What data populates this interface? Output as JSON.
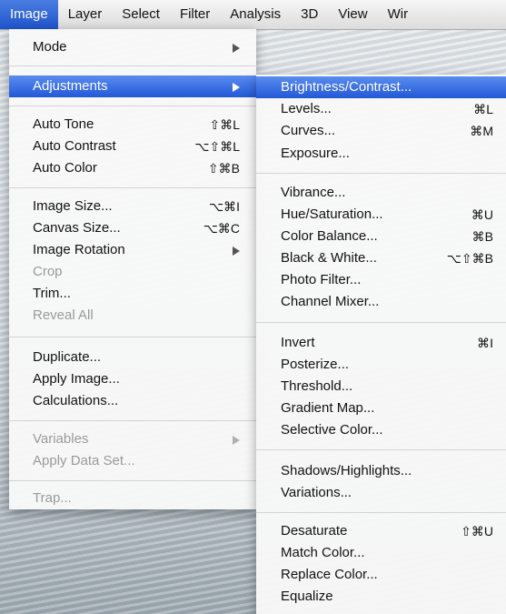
{
  "menubar": {
    "items": [
      "Image",
      "Layer",
      "Select",
      "Filter",
      "Analysis",
      "3D",
      "View",
      "Wir"
    ]
  },
  "image_menu": {
    "mode": "Mode",
    "adjustments": "Adjustments",
    "auto_tone": {
      "label": "Auto Tone",
      "shortcut": "⇧⌘L"
    },
    "auto_contrast": {
      "label": "Auto Contrast",
      "shortcut": "⌥⇧⌘L"
    },
    "auto_color": {
      "label": "Auto Color",
      "shortcut": "⇧⌘B"
    },
    "image_size": {
      "label": "Image Size...",
      "shortcut": "⌥⌘I"
    },
    "canvas_size": {
      "label": "Canvas Size...",
      "shortcut": "⌥⌘C"
    },
    "image_rotation": "Image Rotation",
    "crop": "Crop",
    "trim": "Trim...",
    "reveal_all": "Reveal All",
    "duplicate": "Duplicate...",
    "apply_image": "Apply Image...",
    "calculations": "Calculations...",
    "variables": "Variables",
    "apply_data_set": "Apply Data Set...",
    "trap": "Trap..."
  },
  "adjustments_menu": {
    "brightness_contrast": "Brightness/Contrast...",
    "levels": {
      "label": "Levels...",
      "shortcut": "⌘L"
    },
    "curves": {
      "label": "Curves...",
      "shortcut": "⌘M"
    },
    "exposure": "Exposure...",
    "vibrance": "Vibrance...",
    "hue_saturation": {
      "label": "Hue/Saturation...",
      "shortcut": "⌘U"
    },
    "color_balance": {
      "label": "Color Balance...",
      "shortcut": "⌘B"
    },
    "black_white": {
      "label": "Black & White...",
      "shortcut": "⌥⇧⌘B"
    },
    "photo_filter": "Photo Filter...",
    "channel_mixer": "Channel Mixer...",
    "invert": {
      "label": "Invert",
      "shortcut": "⌘I"
    },
    "posterize": "Posterize...",
    "threshold": "Threshold...",
    "gradient_map": "Gradient Map...",
    "selective_color": "Selective Color...",
    "shadows_highlights": "Shadows/Highlights...",
    "variations": "Variations...",
    "desaturate": {
      "label": "Desaturate",
      "shortcut": "⇧⌘U"
    },
    "match_color": "Match Color...",
    "replace_color": "Replace Color...",
    "equalize": "Equalize"
  },
  "colors": {
    "highlight": "#2258d6",
    "disabled_text": "#9a9a9a"
  }
}
